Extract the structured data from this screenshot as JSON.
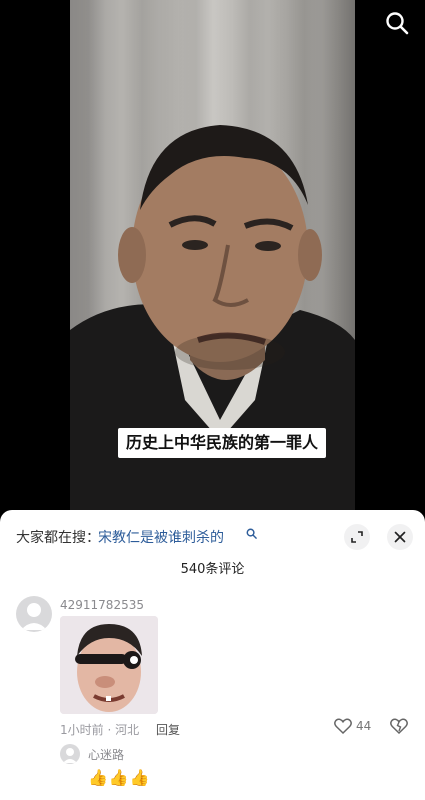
{
  "video": {
    "caption": "历史上中华民族的第一罪人"
  },
  "top_bar": {
    "search_icon": "search-icon"
  },
  "comments_sheet": {
    "search_prefix": "大家都在搜：",
    "search_query": "宋教仁是被谁刺杀的",
    "expand_icon": "expand-icon",
    "close_icon": "close-icon",
    "count_label": "540条评论",
    "comments": [
      {
        "username": "42911782535",
        "sticker": "meme-face-sticker",
        "time": "1小时前",
        "location": "河北",
        "reply_label": "回复",
        "likes": "44",
        "replies": [
          {
            "username": "心迷路",
            "text": "👍👍👍"
          }
        ]
      }
    ]
  }
}
